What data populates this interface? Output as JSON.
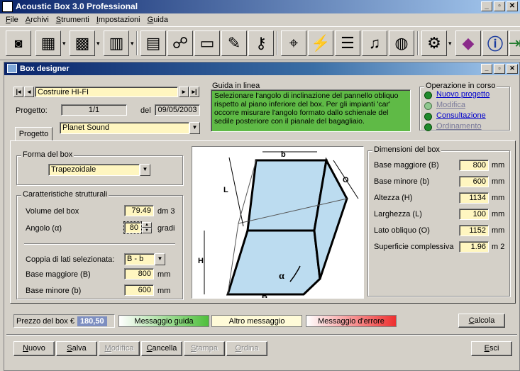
{
  "app": {
    "title": "Acoustic Box 3.0 Professional"
  },
  "menu": [
    "File",
    "Archivi",
    "Strumenti",
    "Impostazioni",
    "Guida"
  ],
  "window": {
    "title": "Box designer"
  },
  "nav": {
    "current": "Costruire HI-FI"
  },
  "progetto": {
    "label": "Progetto:",
    "value": "1/1",
    "del_label": "del",
    "date": "09/05/2003",
    "name": "Planet Sound",
    "tab": "Progetto"
  },
  "guida": {
    "title": "Guida in linea",
    "text": "Selezionare l'angolo di inclinazione del pannello obliquo rispetto al piano inferiore del box. Per gli impianti 'car' occorre misurare l'angolo formato dallo schienale del sedile posteriore con il pianale del bagagliaio."
  },
  "operazione": {
    "title": "Operazione in corso",
    "items": [
      "Nuovo progetto",
      "Modifica",
      "Consultazione",
      "Ordinamento"
    ]
  },
  "forma": {
    "title": "Forma del box",
    "value": "Trapezoidale"
  },
  "caratteristiche": {
    "title": "Caratteristiche strutturali",
    "volume_label": "Volume del box",
    "volume_value": "79.49",
    "volume_unit": "dm 3",
    "angolo_label": "Angolo  (α)",
    "angolo_value": "80",
    "angolo_unit": "gradi",
    "coppia_label": "Coppia di lati selezionata:",
    "coppia_value": "B - b",
    "base_magg_label": "Base maggiore (B)",
    "base_magg_value": "800",
    "base_magg_unit": "mm",
    "base_min_label": "Base minore (b)",
    "base_min_value": "600",
    "base_min_unit": "mm"
  },
  "diagram": {
    "b": "b",
    "O": "O",
    "L": "L",
    "H": "H",
    "B": "B",
    "alpha": "α"
  },
  "dimensioni": {
    "title": "Dimensioni del box",
    "rows": [
      {
        "label": "Base maggiore (B)",
        "value": "800",
        "unit": "mm"
      },
      {
        "label": "Base minore (b)",
        "value": "600",
        "unit": "mm"
      },
      {
        "label": "Altezza (H)",
        "value": "1134",
        "unit": "mm"
      },
      {
        "label": "Larghezza (L)",
        "value": "100",
        "unit": "mm"
      },
      {
        "label": "Lato obliquo (O)",
        "value": "1152",
        "unit": "mm"
      },
      {
        "label": "Superficie complessiva",
        "value": "1.96",
        "unit": "m 2"
      }
    ]
  },
  "status": {
    "prezzo_label": "Prezzo del box €",
    "prezzo_value": "180,50",
    "guida": "Messaggio guida",
    "altro": "Altro messaggio",
    "errore": "Messaggio d'errore",
    "calcola": "Calcola"
  },
  "buttons": {
    "nuovo": "Nuovo",
    "salva": "Salva",
    "modifica": "Modifica",
    "cancella": "Cancella",
    "stampa": "Stampa",
    "ordina": "Ordina",
    "esci": "Esci"
  },
  "colors": {
    "guida_bg": "#5fba46",
    "diagram_fill": "#bcdcf0",
    "prezzo_bg": "#7d8ec0"
  }
}
